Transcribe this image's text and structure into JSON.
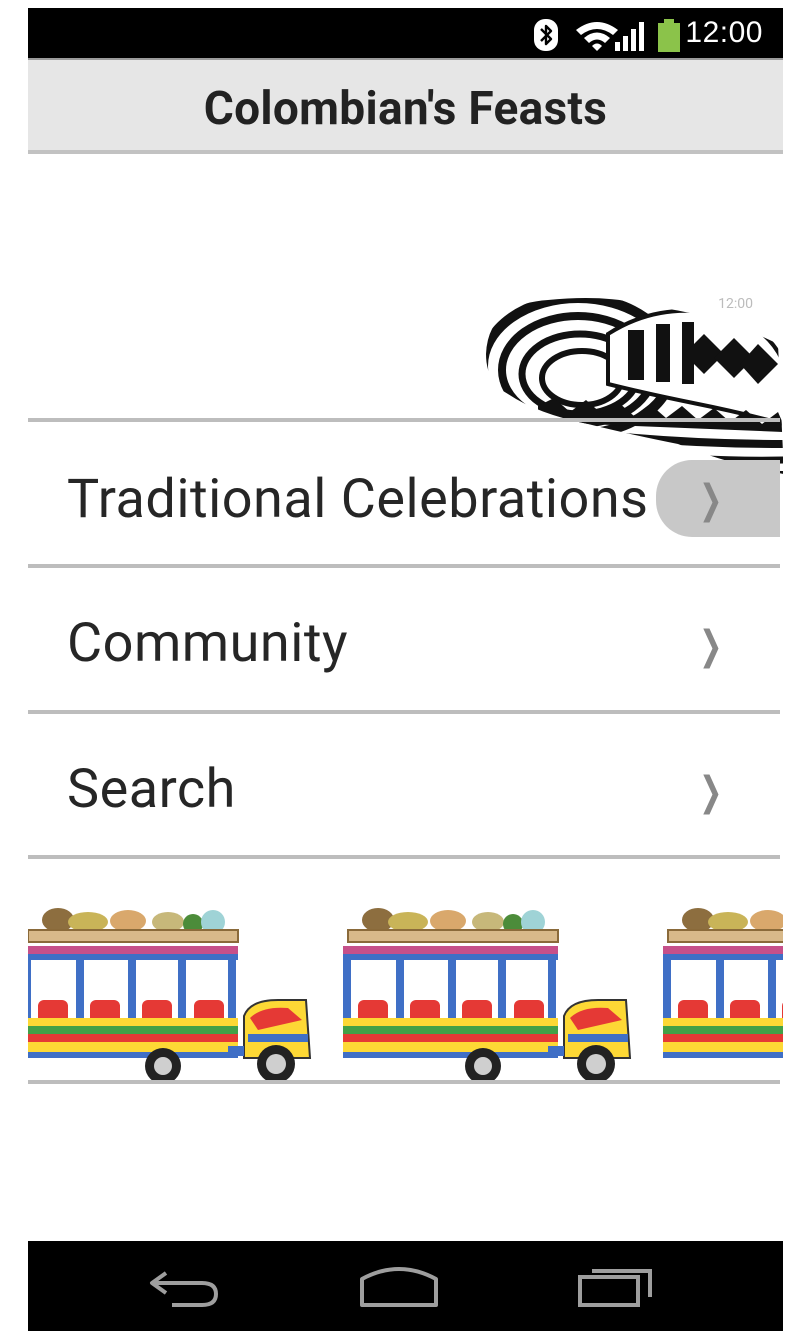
{
  "status_bar": {
    "time": "12:00",
    "icons": [
      "bluetooth-icon",
      "wifi-icon",
      "signal-icon",
      "battery-icon"
    ],
    "battery_color": "#8bc34a"
  },
  "header": {
    "title": "Colombian's Feasts"
  },
  "hero": {
    "image": "sombrero-vueltiao-hat",
    "ghost_time": "12:00"
  },
  "menu": {
    "items": [
      {
        "label": "Traditional Celebrations",
        "icon": "chevron-right-icon",
        "pressed": true
      },
      {
        "label": "Community",
        "icon": "chevron-right-icon",
        "pressed": false
      },
      {
        "label": "Search",
        "icon": "chevron-right-icon",
        "pressed": false
      }
    ]
  },
  "decoration": {
    "image": "chiva-bus-strip"
  },
  "nav_bar": {
    "buttons": [
      "back-icon",
      "home-icon",
      "recent-apps-icon"
    ]
  },
  "colors": {
    "header_bg": "#e6e6e6",
    "divider": "#bdbdbd",
    "text": "#262626"
  }
}
